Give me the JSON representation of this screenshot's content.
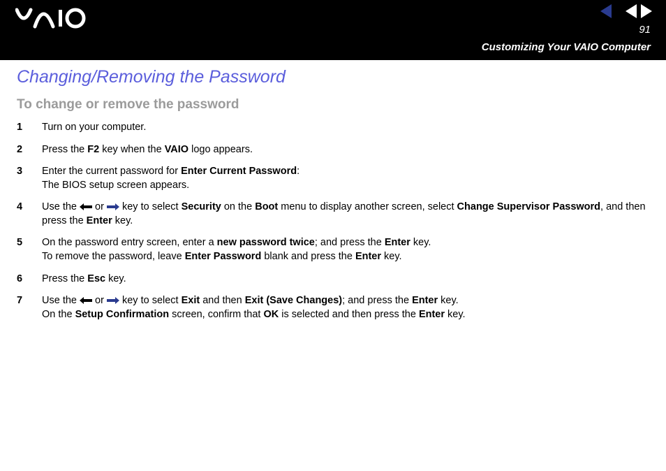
{
  "header": {
    "page_number": "91",
    "section": "Customizing Your VAIO Computer"
  },
  "content": {
    "heading": "Changing/Removing the Password",
    "subheading": "To change or remove the password",
    "steps": [
      {
        "num": "1",
        "html": "Turn on your computer."
      },
      {
        "num": "2",
        "html": "Press the <b>F2</b> key when the <b>VAIO</b> logo appears."
      },
      {
        "num": "3",
        "html": "Enter the current password for <b>Enter Current Password</b>:<br>The BIOS setup screen appears."
      },
      {
        "num": "4",
        "html": "Use the <svg class='arrow' viewBox='0 0 18 10'><path d='M0 5 L6 0 L6 3 L18 3 L18 7 L6 7 L6 10 Z' fill='#000'/></svg> or <svg class='arrow' viewBox='0 0 18 10'><path d='M18 5 L12 0 L12 3 L0 3 L0 7 L12 7 L12 10 Z' fill='#2a3b8f'/></svg> key to select <b>Security</b> on the <b>Boot</b> menu to display another screen, select <b>Change Supervisor Password</b>, and then press the <b>Enter</b> key."
      },
      {
        "num": "5",
        "html": "On the password entry screen, enter a <b>new password twice</b>; and press the <b>Enter</b> key.<br>To remove the password, leave <b>Enter Password</b> blank and press the <b>Enter</b> key."
      },
      {
        "num": "6",
        "html": "Press the <b>Esc</b> key."
      },
      {
        "num": "7",
        "html": "Use the <svg class='arrow' viewBox='0 0 18 10'><path d='M0 5 L6 0 L6 3 L18 3 L18 7 L6 7 L6 10 Z' fill='#000'/></svg> or <svg class='arrow' viewBox='0 0 18 10'><path d='M18 5 L12 0 L12 3 L0 3 L0 7 L12 7 L12 10 Z' fill='#2a3b8f'/></svg> key to select <b>Exit</b> and then <b>Exit (Save Changes)</b>; and press the <b>Enter</b> key.<br>On the <b>Setup Confirmation</b> screen, confirm that <b>OK</b> is selected and then press the <b>Enter</b> key."
      }
    ]
  }
}
